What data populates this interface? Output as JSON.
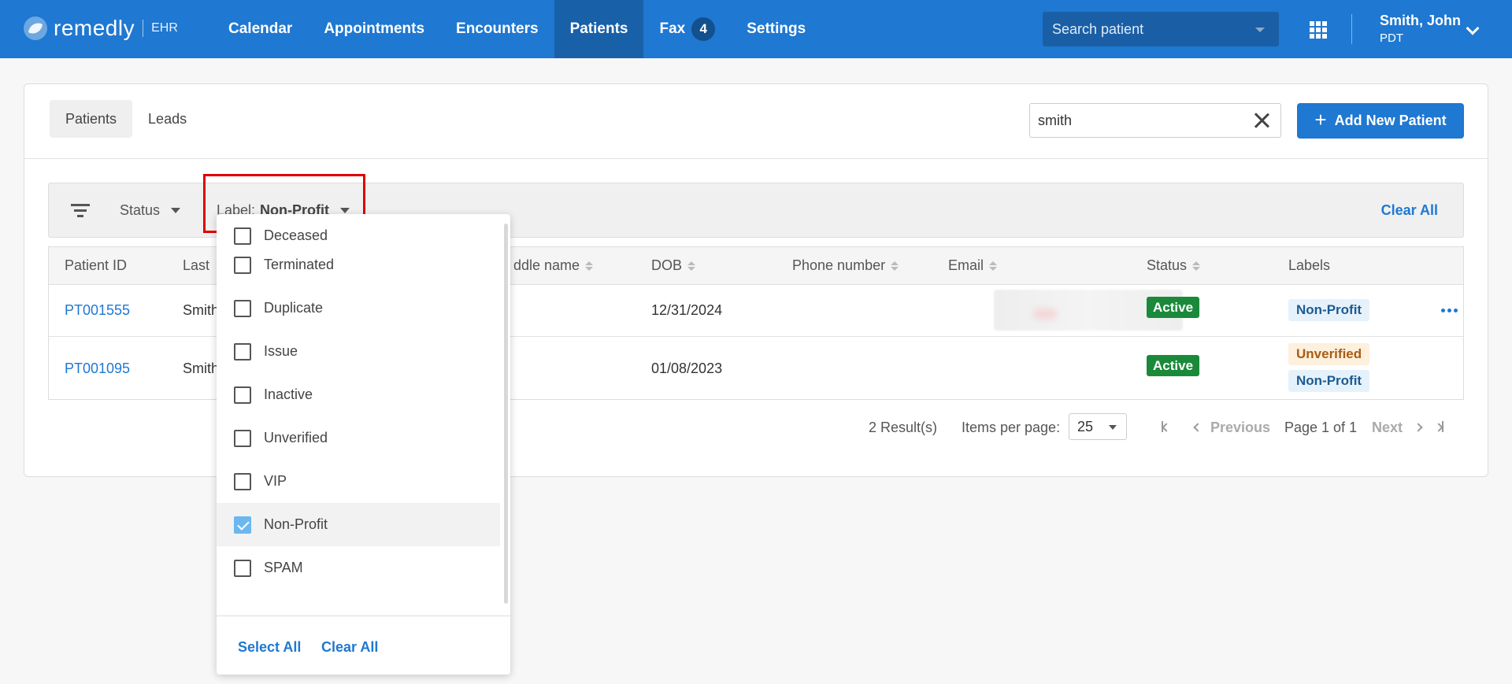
{
  "brand": {
    "name": "remedly",
    "suffix": "EHR"
  },
  "nav": {
    "items": [
      {
        "label": "Calendar"
      },
      {
        "label": "Appointments"
      },
      {
        "label": "Encounters"
      },
      {
        "label": "Patients"
      },
      {
        "label": "Fax"
      },
      {
        "label": "Settings"
      }
    ],
    "fax_count": "4",
    "active": "Patients"
  },
  "header_search": {
    "placeholder": "Search patient"
  },
  "user": {
    "name": "Smith, John",
    "timezone": "PDT"
  },
  "tabs": [
    {
      "label": "Patients"
    },
    {
      "label": "Leads"
    }
  ],
  "search": {
    "value": "smith"
  },
  "add_button": {
    "label": "Add New Patient"
  },
  "filters": {
    "status_label": "Status",
    "label_prefix": "Label:",
    "label_value": "Non-Profit",
    "clear_all": "Clear All"
  },
  "table": {
    "headers": {
      "patient_id": "Patient ID",
      "last": "Last",
      "middle": "ddle name",
      "dob": "DOB",
      "phone": "Phone number",
      "email": "Email",
      "status": "Status",
      "labels": "Labels"
    },
    "rows": [
      {
        "patient_id": "PT001555",
        "last": "Smith",
        "dob": "12/31/2024",
        "status": "Active",
        "labels": [
          "Non-Profit"
        ]
      },
      {
        "patient_id": "PT001095",
        "last": "Smith",
        "dob": "01/08/2023",
        "status": "Active",
        "labels": [
          "Unverified",
          "Non-Profit"
        ]
      }
    ]
  },
  "pagination": {
    "results": "2 Result(s)",
    "items_per_page_label": "Items per page:",
    "items_per_page": "25",
    "previous": "Previous",
    "page_info": "Page 1 of 1",
    "next": "Next"
  },
  "dropdown": {
    "options": [
      {
        "label": "Deceased",
        "checked": false
      },
      {
        "label": "Terminated",
        "checked": false
      },
      {
        "label": "Duplicate",
        "checked": false
      },
      {
        "label": "Issue",
        "checked": false
      },
      {
        "label": "Inactive",
        "checked": false
      },
      {
        "label": "Unverified",
        "checked": false
      },
      {
        "label": "VIP",
        "checked": false
      },
      {
        "label": "Non-Profit",
        "checked": true
      },
      {
        "label": "SPAM",
        "checked": false
      }
    ],
    "select_all": "Select All",
    "clear_all": "Clear All"
  },
  "colors": {
    "primary": "#1f78d1",
    "nav_active": "#1860a8",
    "active_badge": "#1a8a3a",
    "highlight": "#e00000"
  }
}
